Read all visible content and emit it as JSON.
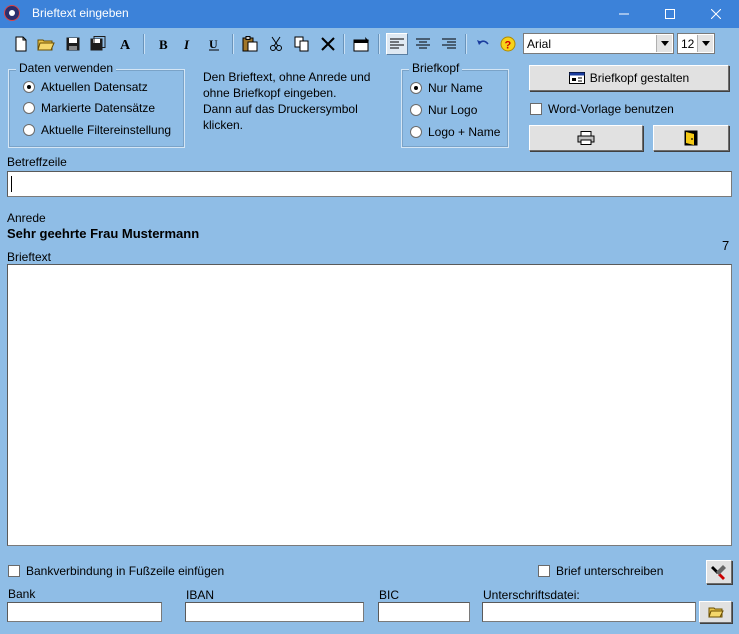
{
  "window": {
    "title": "Brieftext eingeben"
  },
  "toolbar": {
    "font": "Arial",
    "size": "12"
  },
  "daten": {
    "title": "Daten verwenden",
    "options": [
      "Aktuellen Datensatz",
      "Markierte Datensätze",
      "Aktuelle Filtereinstellung"
    ]
  },
  "hint": {
    "line1": "Den Brieftext, ohne Anrede und",
    "line2": "ohne Briefkopf eingeben.",
    "line3": "Dann auf das Druckersymbol",
    "line4": "klicken."
  },
  "briefkopf": {
    "title": "Briefkopf",
    "options": [
      "Nur Name",
      "Nur Logo",
      "Logo + Name"
    ],
    "design_label": "Briefkopf gestalten",
    "word_label": "Word-Vorlage benutzen"
  },
  "betreff": {
    "label": "Betreffzeile",
    "value": ""
  },
  "anrede": {
    "label": "Anrede",
    "value": "Sehr geehrte Frau Mustermann",
    "count": "7"
  },
  "brieftext": {
    "label": "Brieftext",
    "value": ""
  },
  "bottom": {
    "bank_check_label": "Bankverbindung in Fußzeile einfügen",
    "sign_check_label": "Brief unterschreiben",
    "bank_label": "Bank",
    "iban_label": "IBAN",
    "bic_label": "BIC",
    "sigfile_label": "Unterschriftsdatei:"
  },
  "colors": {
    "background": "#8fbde6",
    "titlebar": "#3c82d9"
  }
}
